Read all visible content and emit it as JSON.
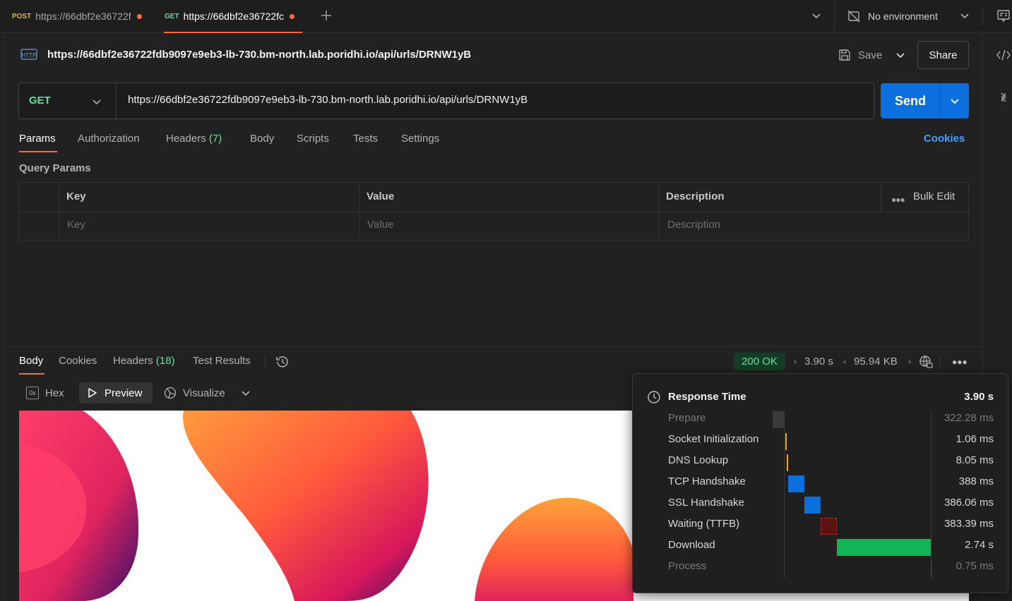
{
  "tabs": [
    {
      "method": "POST",
      "label": "https://66dbf2e36722f",
      "unsaved": true
    },
    {
      "method": "GET",
      "label": "https://66dbf2e36722fc",
      "unsaved": true
    }
  ],
  "environment": {
    "label": "No environment"
  },
  "request": {
    "title": "https://66dbf2e36722fdb9097e9eb3-lb-730.bm-north.lab.poridhi.io/api/urls/DRNW1yB",
    "save_label": "Save",
    "share_label": "Share",
    "method": "GET",
    "url": "https://66dbf2e36722fdb9097e9eb3-lb-730.bm-north.lab.poridhi.io/api/urls/DRNW1yB",
    "send_label": "Send"
  },
  "request_tabs": {
    "params": "Params",
    "authorization": "Authorization",
    "headers": "Headers",
    "headers_count": "(7)",
    "body": "Body",
    "scripts": "Scripts",
    "tests": "Tests",
    "settings": "Settings",
    "cookies": "Cookies"
  },
  "query_params": {
    "section_label": "Query Params",
    "columns": {
      "key": "Key",
      "value": "Value",
      "description": "Description"
    },
    "bulk_edit": "Bulk Edit",
    "placeholders": {
      "key": "Key",
      "value": "Value",
      "description": "Description"
    }
  },
  "response_tabs": {
    "body": "Body",
    "cookies": "Cookies",
    "headers": "Headers",
    "headers_count": "(18)",
    "test_results": "Test Results"
  },
  "response_meta": {
    "status": "200 OK",
    "time": "3.90 s",
    "size": "95.94 KB"
  },
  "preview_toolbar": {
    "hex": "Hex",
    "hex_icon_text": "0x",
    "preview": "Preview",
    "visualize": "Visualize"
  },
  "response_time": {
    "title": "Response Time",
    "total": "3.90 s",
    "phases": [
      {
        "label": "Prepare",
        "value": "322.28 ms",
        "dim": true
      },
      {
        "label": "Socket Initialization",
        "value": "1.06 ms",
        "dim": false
      },
      {
        "label": "DNS Lookup",
        "value": "8.05 ms",
        "dim": false
      },
      {
        "label": "TCP Handshake",
        "value": "388 ms",
        "dim": false
      },
      {
        "label": "SSL Handshake",
        "value": "386.06 ms",
        "dim": false
      },
      {
        "label": "Waiting (TTFB)",
        "value": "383.39 ms",
        "dim": false
      },
      {
        "label": "Download",
        "value": "2.74 s",
        "dim": false
      },
      {
        "label": "Process",
        "value": "0.75 ms",
        "dim": true
      }
    ]
  },
  "colors": {
    "accent": "#ff6c37",
    "send_blue": "#0b6fde",
    "get_green": "#6bdd9a",
    "link_blue": "#4a9eff",
    "bar_blue": "#0b6fde",
    "bar_green": "#0fb557",
    "bar_orange": "#f6a623",
    "bar_red_outline": "#c0392b"
  }
}
